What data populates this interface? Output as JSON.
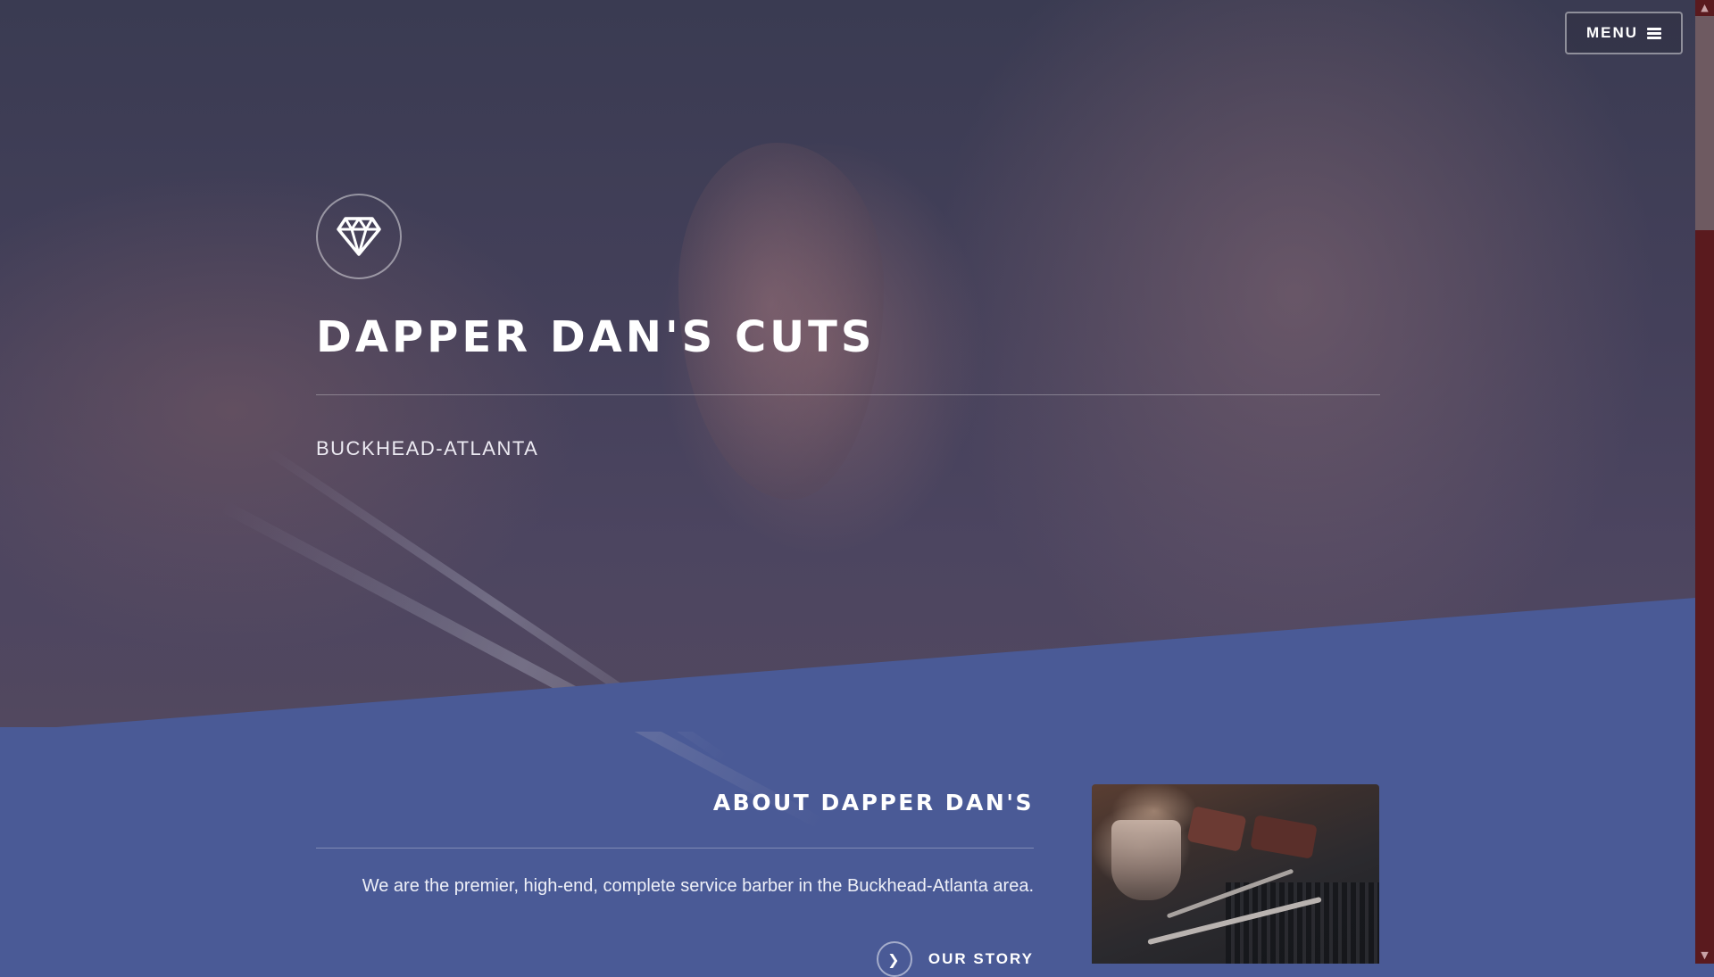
{
  "header": {
    "menu_label": "MENU"
  },
  "hero": {
    "title": "DAPPER DAN'S CUTS",
    "subtitle": "BUCKHEAD-ATLANTA",
    "logo_icon": "diamond-icon"
  },
  "about": {
    "title": "ABOUT DAPPER DAN'S",
    "text": "We are the premier, high-end, complete service barber in the Buckhead-Atlanta area.",
    "link_label": "OUR STORY",
    "link_icon": "chevron-right-icon",
    "image_icon": "barber-tools-photo"
  },
  "colors": {
    "section_bg": "#4a5a96",
    "hero_overlay": "#3f3d55",
    "scrollbar_track": "#5a1a1e"
  }
}
